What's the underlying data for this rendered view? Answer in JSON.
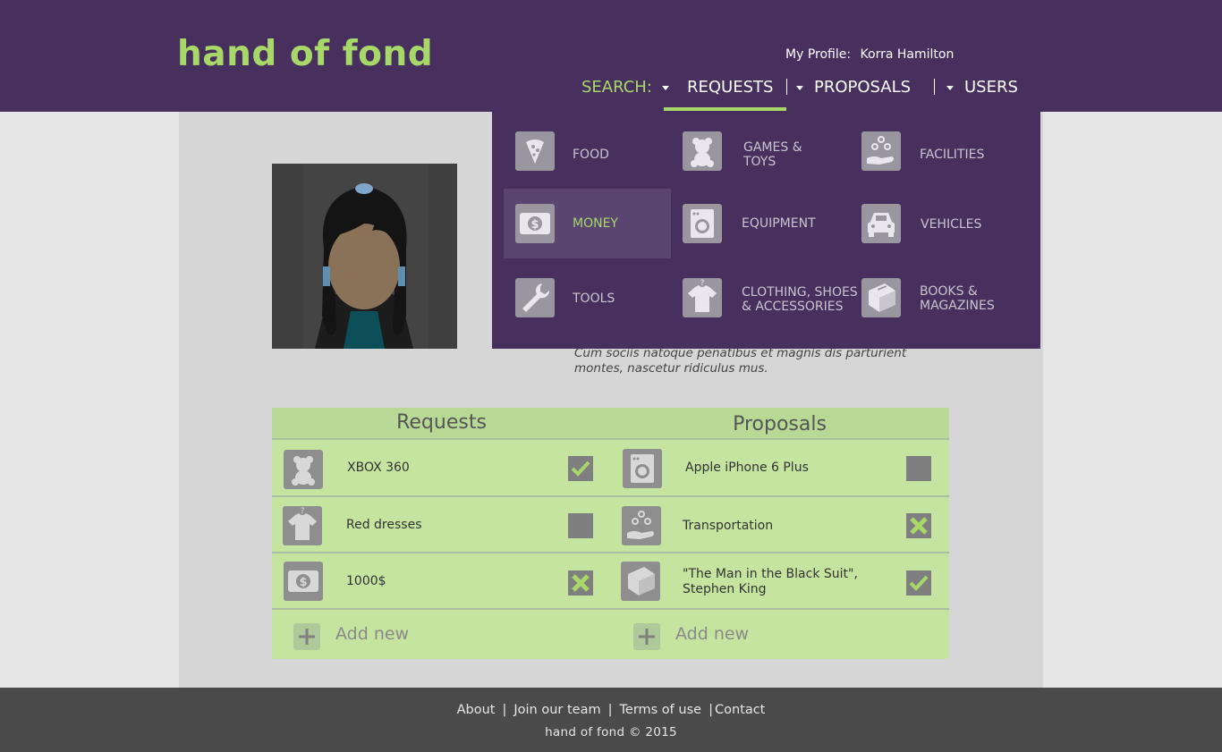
{
  "header": {
    "logo": "hand of fond",
    "profile_label": "My Profile:",
    "profile_name": "Korra Hamilton",
    "search_label": "SEARCH:",
    "nav": [
      {
        "label": "REQUESTS"
      },
      {
        "label": "PROPOSALS"
      },
      {
        "label": "USERS"
      }
    ]
  },
  "dropdown": {
    "items": [
      {
        "label": "FOOD",
        "icon": "pizza-icon"
      },
      {
        "label": "GAMES & TOYS",
        "icon": "teddy-bear-icon"
      },
      {
        "label": "FACILITIES",
        "icon": "hand-bubbles-icon"
      },
      {
        "label": "MONEY",
        "icon": "banknote-icon",
        "active": true
      },
      {
        "label": "EQUIPMENT",
        "icon": "washing-machine-icon"
      },
      {
        "label": "VEHICLES",
        "icon": "car-icon"
      },
      {
        "label": "TOOLS",
        "icon": "wrench-icon"
      },
      {
        "label": "CLOTHING, SHOES & ACCESSORIES",
        "icon": "tshirt-icon"
      },
      {
        "label": "BOOKS & MAGAZINES",
        "icon": "book-icon"
      }
    ]
  },
  "profile": {
    "bio": "Cum sociis natoque penatibus et magnis dis parturient montes, nascetur ridiculus mus."
  },
  "requests": {
    "title": "Requests",
    "items": [
      {
        "text": "XBOX 360",
        "status": "check",
        "icon": "teddy-bear-icon"
      },
      {
        "text": "Red dresses",
        "status": "empty",
        "icon": "tshirt-icon"
      },
      {
        "text": "1000$",
        "status": "cross",
        "icon": "banknote-icon"
      }
    ],
    "add_label": "Add new"
  },
  "proposals": {
    "title": "Proposals",
    "items": [
      {
        "text": "Apple iPhone 6 Plus",
        "status": "empty",
        "icon": "washing-machine-icon"
      },
      {
        "text": "Transportation",
        "status": "cross",
        "icon": "hand-bubbles-icon"
      },
      {
        "text": "\"The Man in the Black Suit\", Stephen King",
        "status": "check",
        "icon": "book-icon"
      }
    ],
    "add_label": "Add new"
  },
  "footer": {
    "links": [
      "About",
      "Join our team",
      "Terms of use",
      "Contact"
    ],
    "copyright": "hand of fond © 2015"
  },
  "colors": {
    "header_bg": "#48305e",
    "accent": "#a8d86a",
    "panel_bg": "#c5e49f",
    "footer_bg": "#4a4a4a"
  }
}
